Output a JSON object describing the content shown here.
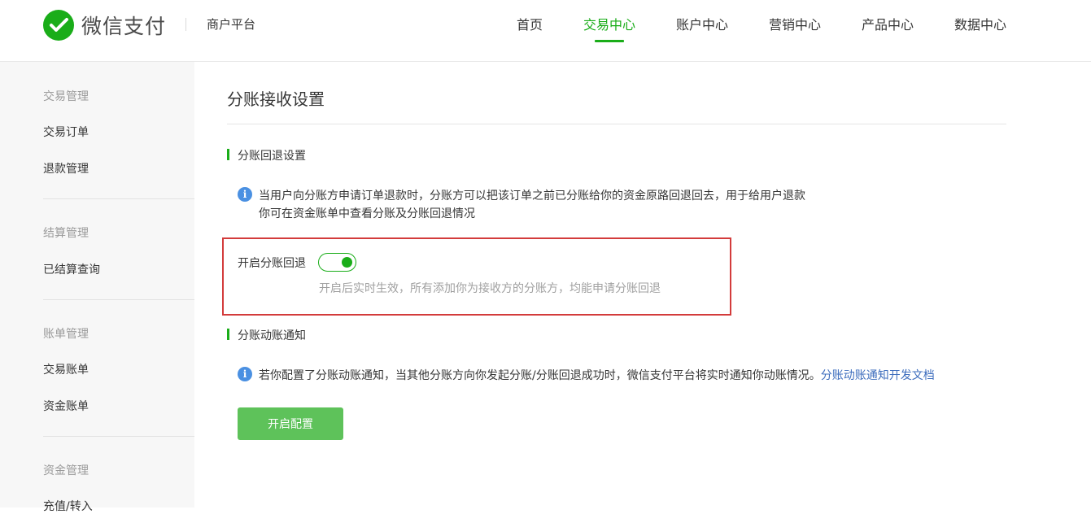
{
  "header": {
    "logo_text": "微信支付",
    "merchant_title": "商户平台",
    "brand_color": "#1aad19",
    "nav": [
      {
        "label": "首页",
        "active": false
      },
      {
        "label": "交易中心",
        "active": true
      },
      {
        "label": "账户中心",
        "active": false
      },
      {
        "label": "营销中心",
        "active": false
      },
      {
        "label": "产品中心",
        "active": false
      },
      {
        "label": "数据中心",
        "active": false
      }
    ]
  },
  "sidebar": {
    "groups": [
      {
        "title": "交易管理",
        "items": [
          "交易订单",
          "退款管理"
        ]
      },
      {
        "title": "结算管理",
        "items": [
          "已结算查询"
        ]
      },
      {
        "title": "账单管理",
        "items": [
          "交易账单",
          "资金账单"
        ]
      },
      {
        "title": "资金管理",
        "items": [
          "充值/转入"
        ]
      }
    ]
  },
  "main": {
    "page_title": "分账接收设置",
    "refund_section": {
      "title": "分账回退设置",
      "info_line1": "当用户向分账方申请订单退款时，分账方可以把该订单之前已分账给你的资金原路回退回去，用于给用户退款",
      "info_line2": "你可在资金账单中查看分账及分账回退情况",
      "toggle_label": "开启分账回退",
      "toggle_on": true,
      "toggle_hint": "开启后实时生效，所有添加你为接收方的分账方，均能申请分账回退"
    },
    "notify_section": {
      "title": "分账动账通知",
      "info_text": "若你配置了分账动账通知，当其他分账方向你发起分账/分账回退成功时，微信支付平台将实时通知你动账情况。",
      "doc_link": "分账动账通知开发文档",
      "button_label": "开启配置"
    }
  }
}
